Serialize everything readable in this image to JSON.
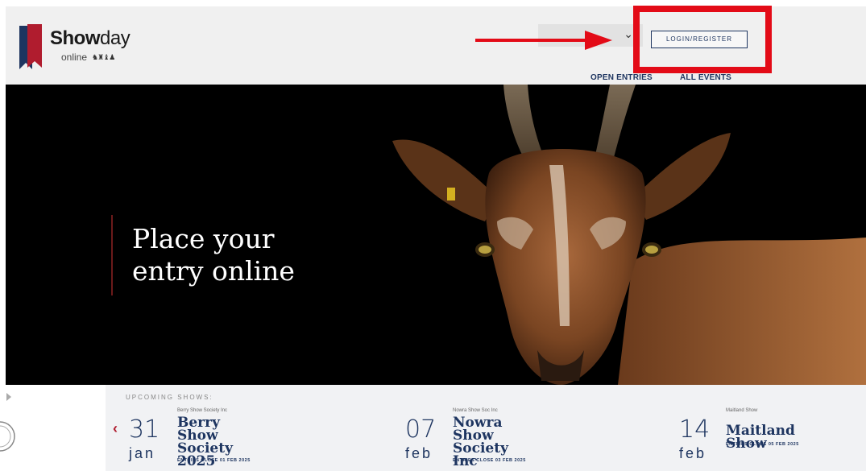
{
  "header": {
    "logo": {
      "word_bold": "Show",
      "word_rest": "day",
      "sub": "online"
    },
    "login_label": "LOGIN/REGISTER",
    "nav": [
      {
        "label": "OPEN ENTRIES"
      },
      {
        "label": "ALL EVENTS"
      }
    ]
  },
  "annotations": {
    "arrow_color": "#e30b17",
    "highlight_color": "#e30b17"
  },
  "hero": {
    "title_line1": "Place your",
    "title_line2": "entry online"
  },
  "upcoming": {
    "heading": "UPCOMING SHOWS:",
    "shows": [
      {
        "day": "31",
        "month": "jan",
        "org": "Berry Show Society Inc",
        "name_line1": "Berry Show Society",
        "name_line2": "2025",
        "entries_close": "ENTRIES CLOSE 01 FEB 2025"
      },
      {
        "day": "07",
        "month": "feb",
        "org": "Nowra Show Soc Inc",
        "name_line1": "Nowra Show Society",
        "name_line2": "Inc",
        "entries_close": "ENTRIES CLOSE 03 FEB 2025"
      },
      {
        "day": "14",
        "month": "feb",
        "org": "Maitland Show",
        "name_line1": "Maitland Show",
        "name_line2": "",
        "entries_close": "ENTRIES CLOSE 05 FEB 2025"
      }
    ]
  },
  "colors": {
    "brand_navy": "#1e3560",
    "brand_red": "#b01c2e",
    "hero_bg": "#000000"
  }
}
